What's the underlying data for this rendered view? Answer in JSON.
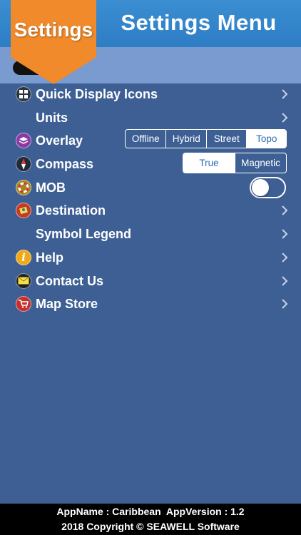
{
  "header": {
    "title": "Settings Menu",
    "banner": "Settings"
  },
  "menu": {
    "items": [
      {
        "label": "Quick Display Icons",
        "icon": "grid-icon"
      },
      {
        "label": "Units"
      },
      {
        "label": "Overlay",
        "icon": "layers-icon",
        "segments": [
          "Offline",
          "Hybrid",
          "Street",
          "Topo"
        ],
        "selected": "Topo"
      },
      {
        "label": "Compass",
        "icon": "compass-icon",
        "segments": [
          "True",
          "Magnetic"
        ],
        "selected": "True"
      },
      {
        "label": "MOB",
        "icon": "lifebuoy-icon",
        "toggle": false
      },
      {
        "label": "Destination",
        "icon": "map-pin-icon"
      },
      {
        "label": "Symbol Legend"
      },
      {
        "label": "Help",
        "icon": "info-icon"
      },
      {
        "label": "Contact Us",
        "icon": "envelope-icon"
      },
      {
        "label": "Map Store",
        "icon": "cart-icon"
      }
    ]
  },
  "footer": {
    "line1": "AppName : Caribbean  AppVersion : 1.2",
    "line2": "2018 Copyright © SEAWELL Software"
  },
  "colors": {
    "background": "#3d5f94",
    "header": "#2d7dc4",
    "subheader": "#7a9bd0",
    "banner": "#f08a2a",
    "footer": "#000000"
  }
}
